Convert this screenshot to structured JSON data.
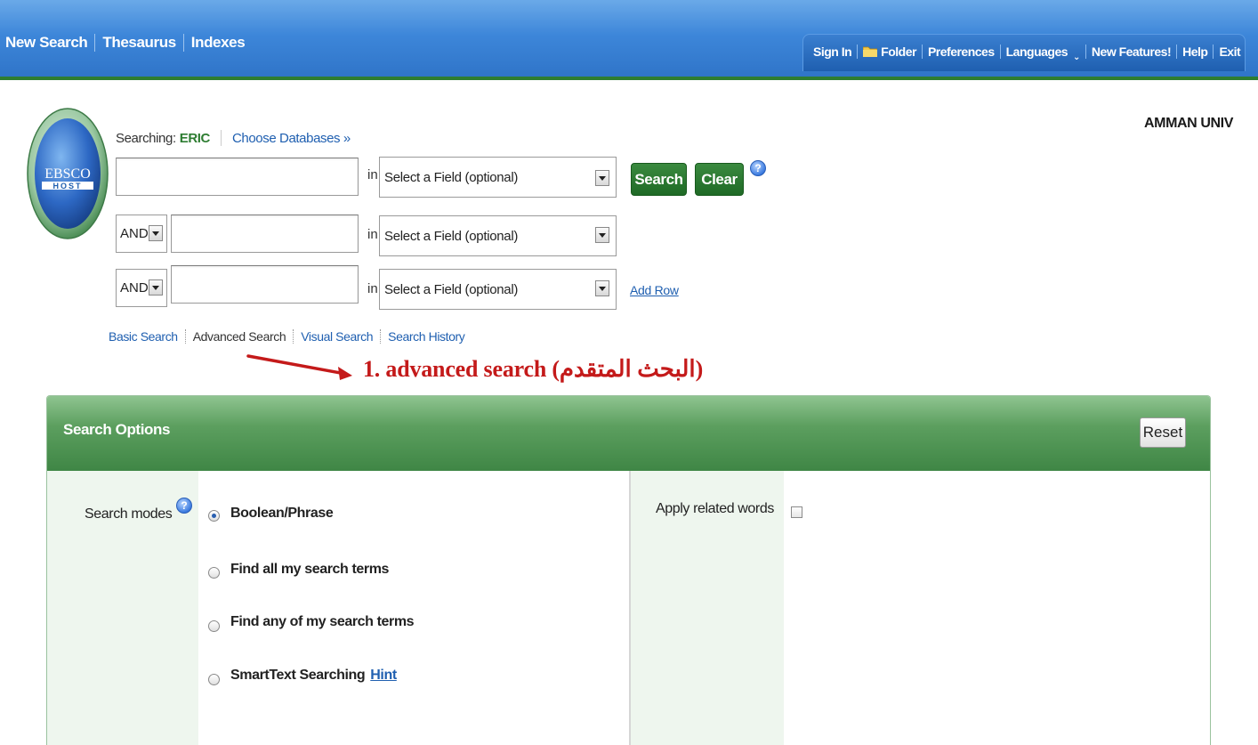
{
  "topnav": {
    "items": [
      "New Search",
      "Thesaurus",
      "Indexes"
    ]
  },
  "utility_nav": {
    "sign_in": "Sign In",
    "folder": "Folder",
    "preferences": "Preferences",
    "languages": "Languages",
    "new_features": "New Features!",
    "help": "Help",
    "exit": "Exit"
  },
  "logo": {
    "line1": "EBSCO",
    "line2": "HOST"
  },
  "org_name": "AMMAN UNIV",
  "searching": {
    "label": "Searching:",
    "database": "ERIC",
    "choose_databases": "Choose Databases »"
  },
  "search_rows": [
    {
      "operator": "",
      "in_label": "in",
      "field": "Select a Field (optional)",
      "value": ""
    },
    {
      "operator": "AND",
      "in_label": "in",
      "field": "Select a Field (optional)",
      "value": ""
    },
    {
      "operator": "AND",
      "in_label": "in",
      "field": "Select a Field (optional)",
      "value": ""
    }
  ],
  "buttons": {
    "search": "Search",
    "clear": "Clear",
    "add_row": "Add Row",
    "reset": "Reset",
    "help_glyph": "?"
  },
  "mode_links": [
    "Basic Search",
    "Advanced Search",
    "Visual Search",
    "Search History"
  ],
  "annotation": {
    "text": "1. advanced search (البحث المتقدم)",
    "color": "#c41a1a"
  },
  "search_options": {
    "title": "Search Options",
    "search_modes_label": "Search modes",
    "modes": [
      {
        "label": "Boolean/Phrase",
        "checked": true
      },
      {
        "label": "Find all my search terms",
        "checked": false
      },
      {
        "label": "Find any of my search terms",
        "checked": false
      },
      {
        "label": "SmartText Searching",
        "checked": false,
        "hint": "Hint"
      }
    ],
    "apply_related_label": "Apply related words",
    "apply_related_checked": false
  },
  "colors": {
    "topbar": "#3d86d9",
    "brand_green": "#2e7d32",
    "link_blue": "#1f5fb0",
    "panel_green": "#5c9f5f"
  }
}
